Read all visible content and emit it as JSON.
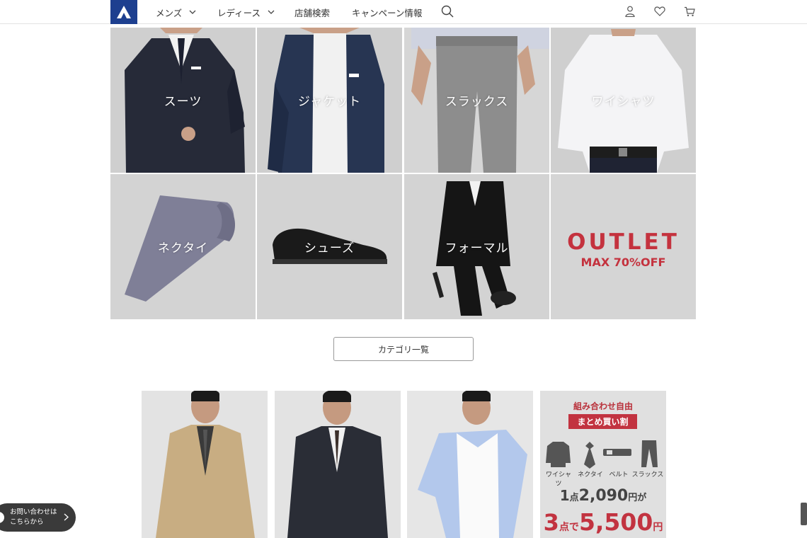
{
  "header": {
    "nav": [
      {
        "label": "メンズ",
        "has_dropdown": true
      },
      {
        "label": "レディース",
        "has_dropdown": true
      },
      {
        "label": "店舗検索",
        "has_dropdown": false
      },
      {
        "label": "キャンペーン情報",
        "has_dropdown": false
      }
    ],
    "icons": [
      "logo-icon",
      "search-icon",
      "account-icon",
      "heart-icon",
      "cart-icon"
    ]
  },
  "categories": [
    {
      "label": "スーツ"
    },
    {
      "label": "ジャケット"
    },
    {
      "label": "スラックス"
    },
    {
      "label": "ワイシャツ"
    },
    {
      "label": "ネクタイ"
    },
    {
      "label": "シューズ"
    },
    {
      "label": "フォーマル"
    }
  ],
  "outlet": {
    "title": "OUTLET",
    "subtitle": "MAX 70%OFF"
  },
  "category_list_button": "カテゴリ一覧",
  "promo": {
    "header": "組み合わせ自由",
    "tag": "まとめ買い割",
    "items": [
      "ワイシャツ",
      "ネクタイ",
      "ベルト",
      "スラックス"
    ],
    "price1": {
      "qty": "1",
      "qty_unit": "点",
      "amount": "2,090",
      "unit": "円が"
    },
    "price2": {
      "qty": "3",
      "qty_unit": "点で",
      "amount": "5,500",
      "unit": "円"
    }
  },
  "contact": {
    "line1": "お問い合わせは",
    "line2": "こちらから"
  },
  "colors": {
    "brand": "#1d3f8f",
    "outlet_red": "#c4323e",
    "promo_red": "#c23340"
  }
}
